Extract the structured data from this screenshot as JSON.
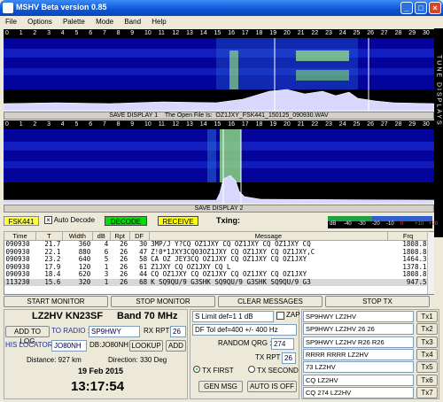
{
  "window": {
    "title": "MSHV Beta version 0.85"
  },
  "menu": [
    "File",
    "Options",
    "Palette",
    "Mode",
    "Band",
    "Help"
  ],
  "scale": [
    "0",
    "1",
    "2",
    "3",
    "4",
    "5",
    "6",
    "7",
    "8",
    "9",
    "10",
    "11",
    "12",
    "13",
    "14",
    "15",
    "16",
    "17",
    "18",
    "19",
    "20",
    "21",
    "22",
    "23",
    "24",
    "25",
    "26",
    "27",
    "28",
    "29",
    "30"
  ],
  "display1": {
    "save_label": "SAVE DISPLAY 1",
    "file_label": "The Open File Is:",
    "file_name": "OZ1JXY_FSK441_150125_090930.WAV"
  },
  "display2": {
    "save_label": "SAVE DISPLAY 2"
  },
  "tune_label": "TUNE DISPLAYS",
  "controls": {
    "mode": "FSK441",
    "auto_decode": "Auto Decode",
    "decode": "DECODE",
    "receive": "RECEIVE",
    "txing": "Txing:"
  },
  "meter": {
    "ticks": [
      "dB",
      "-40",
      "-30",
      "-20",
      "-10",
      "0",
      "+10",
      "+20"
    ],
    "green_share": "42%",
    "blue_share": "58%"
  },
  "columns": [
    "Time",
    "T",
    "Width",
    "dB",
    "Rpt",
    "DF",
    "Message",
    "Frq"
  ],
  "rows": [
    {
      "time": "090930",
      "t": "21.7",
      "width": "360",
      "db": "4",
      "rpt": "26",
      "df": "30",
      "msg": "3MP/J Y?CQ OZ1JXY CQ OZ1JXY CQ OZ1JXY CQ",
      "frq": "1808.8"
    },
    {
      "time": "090930",
      "t": "22.1",
      "width": "880",
      "db": "6",
      "rpt": "26",
      "df": "47",
      "msg": "Z!0*1JXY3CQ03OZ1JXY CQ OZ1JXY CQ OZ1JXY,C",
      "frq": "1808.8"
    },
    {
      "time": "090930",
      "t": "23.2",
      "width": "640",
      "db": "5",
      "rpt": "26",
      "df": "58",
      "msg": "CA OZ JEY3CQ OZ1JXY CQ OZ1JXY CQ OZ1JXY",
      "frq": "1464.3"
    },
    {
      "time": "090930",
      "t": "17.9",
      "width": "120",
      "db": "1",
      "rpt": "26",
      "df": "61",
      "msg": "Z1JXY CQ OZ1JXY CQ L",
      "frq": "1378.1"
    },
    {
      "time": "090930",
      "t": "18.4",
      "width": "620",
      "db": "3",
      "rpt": "26",
      "df": "44",
      "msg": "CQ OZ1JXY CQ OZ1JXY CQ OZ1JXY CQ OZ1JXY",
      "frq": "1808.8"
    },
    {
      "time": "113230",
      "t": "15.6",
      "width": "320",
      "db": "1",
      "rpt": "26",
      "df": "68",
      "msg": "K SQ9QU/9 G3SHK SQ9QU/9 G3SHK SQ9QU/9 G3",
      "frq": "947.5"
    }
  ],
  "buttons": {
    "start": "START MONITOR",
    "stop": "STOP MONITOR",
    "clear": "CLEAR MESSAGES",
    "stoptx": "STOP TX"
  },
  "station": {
    "my": "LZ2HV KN23SF",
    "band": "Band 70 MHz",
    "add_log": "ADD TO LOG",
    "to_radio": "TO RADIO :",
    "call": "SP9HWY",
    "rx_rpt_label": "RX RPT :",
    "rx_rpt": "26",
    "his_loc": "HIS LOCATOR",
    "loc": "JO80NH",
    "db": "DB:JO80NH",
    "lookup": "LOOKUP",
    "add": "ADD",
    "distance": "Distance:  927 km",
    "direction": "Direction:  330 Deg",
    "date": "19 Feb 2015",
    "time": "13:17:54"
  },
  "settings": {
    "slimit": "S Limit def=1  1  dB",
    "zap": "ZAP",
    "dftol": "DF Tol def=400 +/-  400  Hz",
    "random_label": "RANDOM QRG :",
    "random": "274",
    "txrpt_label": "TX RPT :",
    "txrpt": "26",
    "txfirst": "TX FIRST",
    "txsecond": "TX SECOND",
    "genmsg": "GEN MSG",
    "auto": "AUTO IS OFF"
  },
  "tx": [
    {
      "msg": "SP9HWY LZ2HV",
      "btn": "Tx1"
    },
    {
      "msg": "SP9HWY LZ2HV 26 26",
      "btn": "Tx2"
    },
    {
      "msg": "SP9HWY LZ2HV R26 R26",
      "btn": "Tx3"
    },
    {
      "msg": "RRRR RRRR LZ2HV",
      "btn": "Tx4"
    },
    {
      "msg": "73 LZ2HV",
      "btn": "Tx5"
    },
    {
      "msg": "CQ LZ2HV",
      "btn": "Tx6"
    },
    {
      "msg": "CQ 274 LZ2HV",
      "btn": "Tx7"
    }
  ],
  "colors": {
    "decode": "#00e000",
    "receive": "#ffff00",
    "mode": "#ffff40",
    "spectrum": "#04049c"
  }
}
